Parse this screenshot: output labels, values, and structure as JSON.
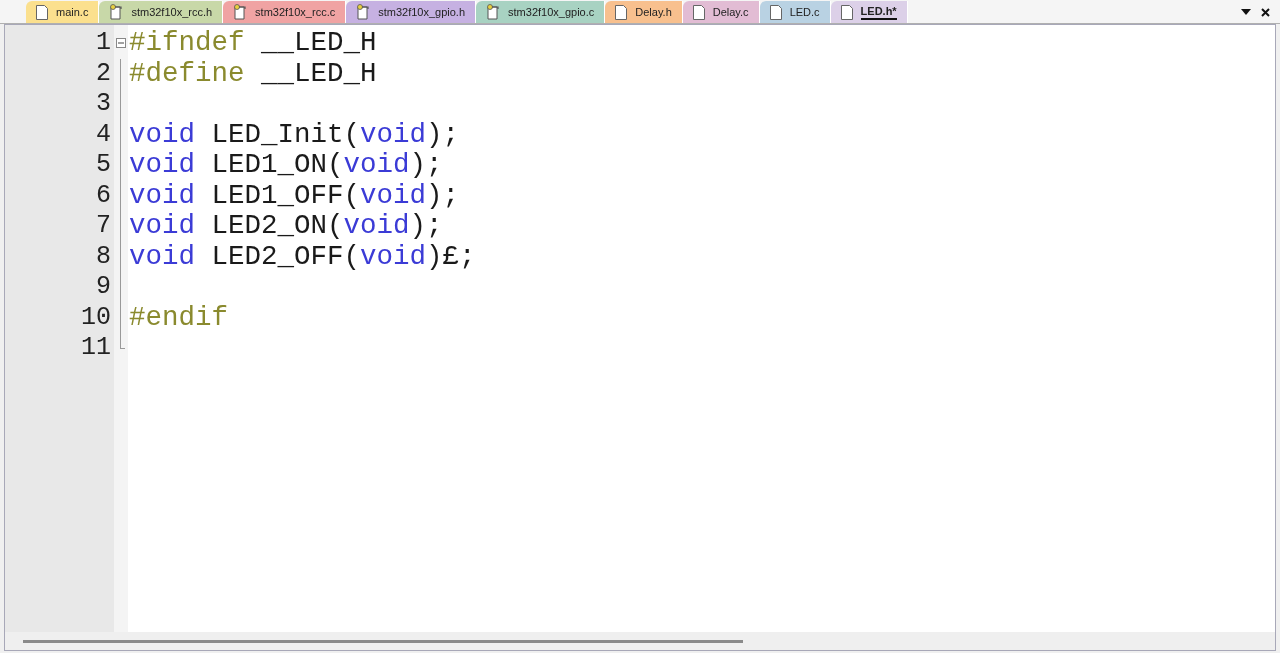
{
  "tabs": [
    {
      "label": "main.c",
      "kind": "file",
      "color": "#fbe08e",
      "selected": false
    },
    {
      "label": "stm32f10x_rcc.h",
      "kind": "key",
      "color": "#c8d8a8",
      "selected": false
    },
    {
      "label": "stm32f10x_rcc.c",
      "kind": "key",
      "color": "#f0a3a3",
      "selected": false
    },
    {
      "label": "stm32f10x_gpio.h",
      "kind": "key",
      "color": "#c6b1e2",
      "selected": false
    },
    {
      "label": "stm32f10x_gpio.c",
      "kind": "key",
      "color": "#a8d2c2",
      "selected": false
    },
    {
      "label": "Delay.h",
      "kind": "file",
      "color": "#f8c08e",
      "selected": false
    },
    {
      "label": "Delay.c",
      "kind": "file",
      "color": "#e2bcd4",
      "selected": false
    },
    {
      "label": "LED.c",
      "kind": "file",
      "color": "#b9d2e3",
      "selected": false
    },
    {
      "label": "LED.h*",
      "kind": "file",
      "color": "#dcd0e8",
      "selected": true
    }
  ],
  "editor": {
    "lines": [
      {
        "number": "1",
        "tokens": [
          {
            "kind": "preprocessor",
            "text": "#ifndef"
          },
          {
            "kind": "plain",
            "text": " __LED_H"
          }
        ]
      },
      {
        "number": "2",
        "tokens": [
          {
            "kind": "preprocessor",
            "text": "#define"
          },
          {
            "kind": "plain",
            "text": " __LED_H"
          }
        ]
      },
      {
        "number": "3"
      },
      {
        "number": "4",
        "tokens": [
          {
            "kind": "keyword",
            "text": "void"
          },
          {
            "kind": "plain",
            "text": " LED_Init("
          },
          {
            "kind": "keyword",
            "text": "void"
          },
          {
            "kind": "plain",
            "text": ");"
          }
        ]
      },
      {
        "number": "5",
        "tokens": [
          {
            "kind": "keyword",
            "text": "void"
          },
          {
            "kind": "plain",
            "text": " LED1_ON("
          },
          {
            "kind": "keyword",
            "text": "void"
          },
          {
            "kind": "plain",
            "text": ");"
          }
        ]
      },
      {
        "number": "6",
        "tokens": [
          {
            "kind": "keyword",
            "text": "void"
          },
          {
            "kind": "plain",
            "text": " LED1_OFF("
          },
          {
            "kind": "keyword",
            "text": "void"
          },
          {
            "kind": "plain",
            "text": ");"
          }
        ]
      },
      {
        "number": "7",
        "tokens": [
          {
            "kind": "keyword",
            "text": "void"
          },
          {
            "kind": "plain",
            "text": " LED2_ON("
          },
          {
            "kind": "keyword",
            "text": "void"
          },
          {
            "kind": "plain",
            "text": ");"
          }
        ]
      },
      {
        "number": "8",
        "tokens": [
          {
            "kind": "keyword",
            "text": "void"
          },
          {
            "kind": "plain",
            "text": " LED2_OFF("
          },
          {
            "kind": "keyword",
            "text": "void"
          },
          {
            "kind": "plain",
            "text": ")£;"
          }
        ]
      },
      {
        "number": "9"
      },
      {
        "number": "10",
        "tokens": [
          {
            "kind": "preprocessor",
            "text": "#endif"
          }
        ]
      },
      {
        "number": "11"
      }
    ]
  }
}
